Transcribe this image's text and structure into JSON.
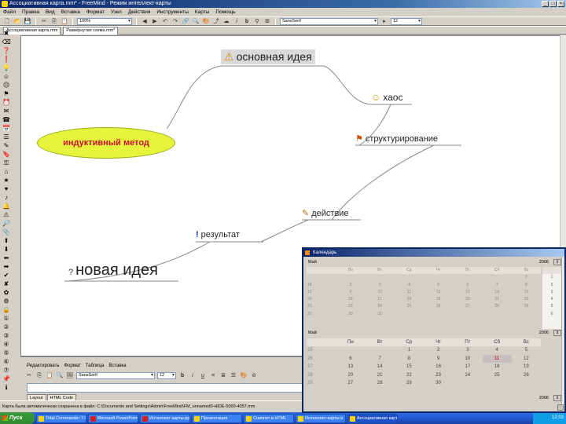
{
  "app": {
    "title": "Ассоциативная карта.mm* - FreeMind - Режим интеллект-карты"
  },
  "menu": [
    "Файл",
    "Правка",
    "Вид",
    "Вставка",
    "Формат",
    "Узел",
    "Действия",
    "Инструменты",
    "Карты",
    "Помощь"
  ],
  "toolbar": {
    "zoom_value": "100%",
    "font_value": "SansSerif",
    "size_value": "12"
  },
  "tabs": {
    "map_tab_1": "Ассоциативная карта.mm",
    "map_tab_2": "Развёрнутая схема.mm*"
  },
  "mindmap": {
    "root": "индуктивный метод",
    "main_idea": "основная идея",
    "chaos": "хаос",
    "structuring": "структурирование",
    "action": "действие",
    "result": "результат",
    "new_idea": "новая идея"
  },
  "icons": {
    "main_idea": "warning-icon",
    "chaos": "smiley-icon",
    "structuring": "flag-icon",
    "action": "pencil-icon",
    "result": "exclamation-icon",
    "new_idea": "question-icon"
  },
  "notes_panel": {
    "menu": [
      "Редактировать",
      "Формат",
      "Таблица",
      "Вставка"
    ],
    "font_value": "SansSerif",
    "size_value": "12",
    "tab_layout": "Layout",
    "tab_html": "HTML Code"
  },
  "statusbar": {
    "text": "Карта была автоматически сохранена в файл: C:\\Documents and Settings\\Admin\\FreeMind\\FM_unnamed0-HIDE-5000-4057.mm"
  },
  "calendar_window": {
    "title": "Календарь",
    "month_label": "Май",
    "top_year": "2006",
    "year_value": "2006",
    "lower_year": "2006",
    "weekdays": [
      "Пн",
      "Вт",
      "Ср",
      "Чт",
      "Пт",
      "Сб",
      "Вс"
    ],
    "top_weeks": [
      {
        "wk": "",
        "days": [
          "",
          "",
          "",
          "",
          "",
          "",
          "1"
        ]
      },
      {
        "wk": "18",
        "days": [
          "2",
          "3",
          "4",
          "5",
          "6",
          "7",
          "8"
        ]
      },
      {
        "wk": "19",
        "days": [
          "9",
          "10",
          "11",
          "12",
          "13",
          "14",
          "15"
        ]
      },
      {
        "wk": "20",
        "days": [
          "16",
          "17",
          "18",
          "19",
          "20",
          "21",
          "22"
        ]
      },
      {
        "wk": "21",
        "days": [
          "23",
          "24",
          "25",
          "26",
          "27",
          "28",
          "29"
        ]
      },
      {
        "wk": "22",
        "days": [
          "30",
          "31",
          "",
          "",
          "",
          "",
          ""
        ]
      }
    ],
    "main_weeks": [
      {
        "wk": "25",
        "days": [
          "",
          "",
          "1",
          "2",
          "3",
          "4",
          "5"
        ]
      },
      {
        "wk": "26",
        "days": [
          "6",
          "7",
          "8",
          "9",
          "10",
          "11",
          "12"
        ]
      },
      {
        "wk": "27",
        "days": [
          "13",
          "14",
          "15",
          "16",
          "17",
          "18",
          "19"
        ]
      },
      {
        "wk": "28",
        "days": [
          "20",
          "21",
          "22",
          "23",
          "24",
          "25",
          "26"
        ]
      },
      {
        "wk": "29",
        "days": [
          "27",
          "28",
          "29",
          "30",
          "",
          "",
          ""
        ]
      }
    ],
    "selected_day": "11",
    "right_column": [
      "1",
      "2",
      "3",
      "4",
      "5",
      "6"
    ]
  },
  "taskbar": {
    "start": "Пуск",
    "items": [
      "Total Commander 7.0",
      "Microsoft PowerPoint",
      "Интеллект-карты.ppt",
      "Презентация",
      "Сниппет в HTML",
      "Интеллект-карты в",
      "Ассоциативная карта"
    ],
    "clock": "12:03"
  }
}
